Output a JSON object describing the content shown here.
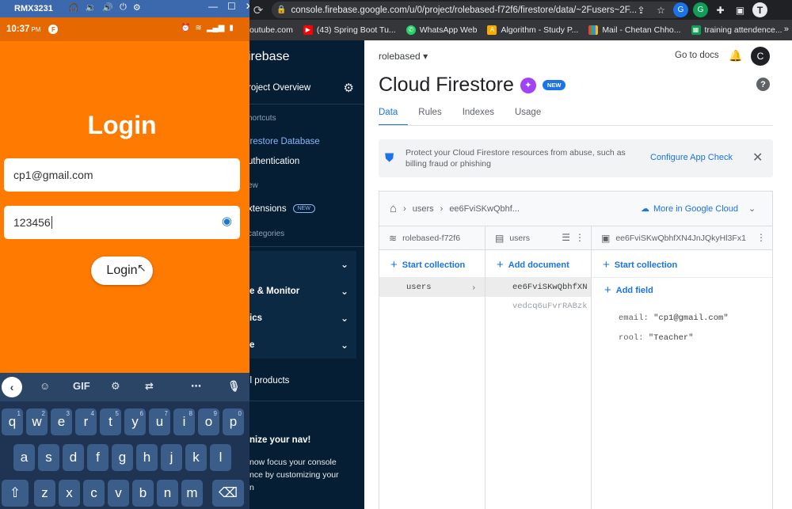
{
  "browser": {
    "url": "console.firebase.google.com/u/0/project/rolebased-f72f6/firestore/data/~2Fusers~2F...",
    "profile_initial": "T",
    "bookmarks": [
      {
        "label": "outube.com",
        "color": "#ff0000"
      },
      {
        "label": "(43) Spring Boot Tu...",
        "color": "#ff0000"
      },
      {
        "label": "WhatsApp Web",
        "color": "#25d366"
      },
      {
        "label": "Algorithm - Study P...",
        "color": "#f9ab00"
      },
      {
        "label": "Mail - Chetan Chho...",
        "color": "#ea4335"
      },
      {
        "label": "training attendence...",
        "color": "#0f9d58"
      }
    ],
    "bookmarks_more": "»"
  },
  "firebase_nav": {
    "brand": "irebase",
    "project_overview": "roject Overview",
    "shortcuts_label": "hortcuts",
    "firestore_item": "irestore Database",
    "auth_item": "uthentication",
    "view_label": "ew",
    "extensions_item": "xtensions",
    "extensions_badge": "NEW",
    "categories_label": "categories",
    "group_build": "",
    "group_release": "e & Monitor",
    "group_analytics": "ics",
    "group_engage": "e",
    "all_products": "ll products",
    "customize_title": "nize your nav!",
    "customize_body_1": "now focus your console",
    "customize_body_2": "nce by customizing your",
    "customize_body_3": "n"
  },
  "firestore": {
    "project": "rolebased",
    "go_to_docs": "Go to docs",
    "avatar_initial": "C",
    "title": "Cloud Firestore",
    "new_badge": "NEW",
    "tabs": [
      "Data",
      "Rules",
      "Indexes",
      "Usage"
    ],
    "banner_text": "Protect your Cloud Firestore resources from abuse, such as billing fraud or phishing",
    "banner_link": "Configure App Check",
    "crumb_1": "users",
    "crumb_2": "ee6FviSKwQbhf...",
    "more_in_cloud": "More in Google Cloud",
    "col1": {
      "header": "rolebased-f72f6",
      "action": "Start collection",
      "rows": [
        "users"
      ]
    },
    "col2": {
      "header": "users",
      "action": "Add document",
      "rows": [
        "ee6FviSKwQbhfXN",
        "vedcq6uFvrRABzk"
      ]
    },
    "col3": {
      "header": "ee6FviSKwQbhfXN4JnJQkyHl3Fx1",
      "action": "Start collection",
      "add_field": "Add field",
      "fields": [
        {
          "key": "email:",
          "value": "\"cp1@gmail.com\""
        },
        {
          "key": "rool:",
          "value": "\"Teacher\""
        }
      ]
    }
  },
  "phone": {
    "emulator_title": "RMX3231",
    "time": "10:37",
    "ampm": "PM",
    "app_icon": "F",
    "login_title": "Login",
    "email_value": "cp1@gmail.com",
    "password_value": "123456",
    "login_button": "Login",
    "keyboard": {
      "gif_label": "GIF",
      "row1": [
        "q",
        "w",
        "e",
        "r",
        "t",
        "y",
        "u",
        "i",
        "o",
        "p"
      ],
      "row1_nums": [
        "1",
        "2",
        "3",
        "4",
        "5",
        "6",
        "7",
        "8",
        "9",
        "0"
      ],
      "row2": [
        "a",
        "s",
        "d",
        "f",
        "g",
        "h",
        "j",
        "k",
        "l"
      ],
      "row3": [
        "z",
        "x",
        "c",
        "v",
        "b",
        "n",
        "m"
      ]
    }
  }
}
